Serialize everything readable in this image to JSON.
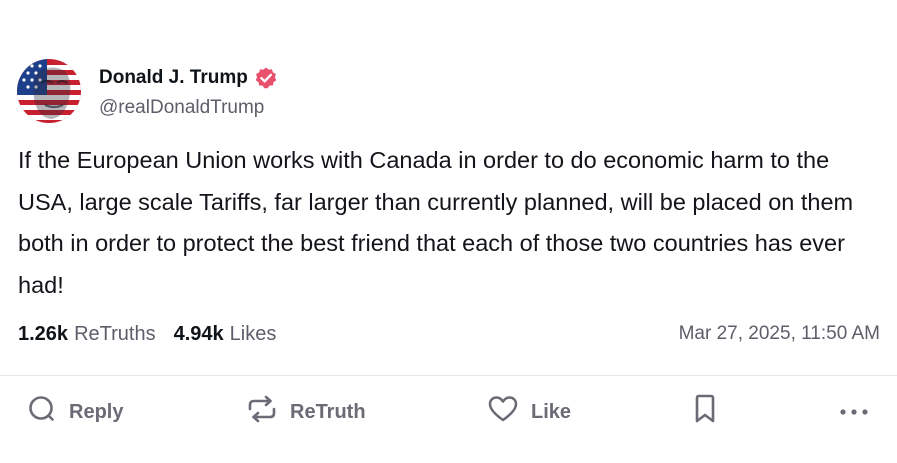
{
  "author": {
    "display_name": "Donald J. Trump",
    "handle": "@realDonaldTrump",
    "verified": true,
    "verified_color": "#e8506e"
  },
  "post": {
    "text": "If the European Union works with Canada in order to do economic harm to the USA, large scale Tariffs, far larger than currently planned, will be placed on them both in order to protect the best friend that each of those two countries has ever had!",
    "timestamp": "Mar 27, 2025, 11:50 AM"
  },
  "stats": {
    "retruths_count": "1.26k",
    "retruths_label": "ReTruths",
    "likes_count": "4.94k",
    "likes_label": "Likes"
  },
  "actions": {
    "reply_label": "Reply",
    "retruth_label": "ReTruth",
    "like_label": "Like"
  },
  "icons": {
    "reply": "reply-icon",
    "retruth": "retruth-icon",
    "like": "heart-icon",
    "bookmark": "bookmark-icon",
    "more": "more-icon",
    "verified": "verified-badge-icon"
  },
  "colors": {
    "text_primary": "#0f1419",
    "text_secondary": "#5e5e6a",
    "icon_gray": "#6b6b76"
  }
}
